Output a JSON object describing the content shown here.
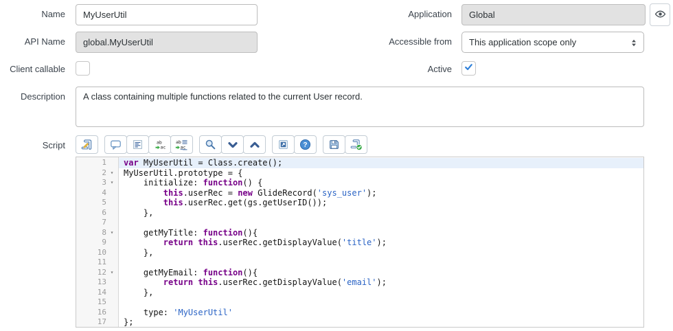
{
  "form": {
    "name": {
      "label": "Name",
      "value": "MyUserUtil"
    },
    "application": {
      "label": "Application",
      "value": "Global"
    },
    "api_name": {
      "label": "API Name",
      "value": "global.MyUserUtil"
    },
    "accessible_from": {
      "label": "Accessible from",
      "value": "This application scope only"
    },
    "client_callable": {
      "label": "Client callable",
      "checked": false
    },
    "active": {
      "label": "Active",
      "checked": true
    },
    "description": {
      "label": "Description",
      "value": "A class containing multiple functions related to the current User record."
    },
    "script": {
      "label": "Script"
    }
  },
  "toolbar": {
    "groups": [
      [
        "edit-script"
      ],
      [
        "toggle-comment",
        "format-code",
        "replace",
        "replace-all"
      ],
      [
        "search",
        "find-next",
        "find-previous"
      ],
      [
        "open-in-new-window",
        "help"
      ],
      [
        "save",
        "syntax-check"
      ]
    ]
  },
  "editor": {
    "colors": {
      "keyword": "#770088",
      "string": "#2a63c5",
      "active_line": "#e7f0fb"
    },
    "lines": [
      {
        "n": 1,
        "active": true,
        "fold": false,
        "tokens": [
          [
            "k",
            "var"
          ],
          [
            "t",
            " MyUserUtil = Class.create();"
          ]
        ]
      },
      {
        "n": 2,
        "active": false,
        "fold": true,
        "tokens": [
          [
            "t",
            "MyUserUtil.prototype = {"
          ]
        ]
      },
      {
        "n": 3,
        "active": false,
        "fold": true,
        "tokens": [
          [
            "t",
            "    initialize: "
          ],
          [
            "k",
            "function"
          ],
          [
            "t",
            "() {"
          ]
        ]
      },
      {
        "n": 4,
        "active": false,
        "fold": false,
        "tokens": [
          [
            "t",
            "        "
          ],
          [
            "k",
            "this"
          ],
          [
            "t",
            ".userRec = "
          ],
          [
            "k",
            "new"
          ],
          [
            "t",
            " GlideRecord("
          ],
          [
            "s",
            "'sys_user'"
          ],
          [
            "t",
            ");"
          ]
        ]
      },
      {
        "n": 5,
        "active": false,
        "fold": false,
        "tokens": [
          [
            "t",
            "        "
          ],
          [
            "k",
            "this"
          ],
          [
            "t",
            ".userRec.get(gs.getUserID());"
          ]
        ]
      },
      {
        "n": 6,
        "active": false,
        "fold": false,
        "tokens": [
          [
            "t",
            "    },"
          ]
        ]
      },
      {
        "n": 7,
        "active": false,
        "fold": false,
        "tokens": []
      },
      {
        "n": 8,
        "active": false,
        "fold": true,
        "tokens": [
          [
            "t",
            "    getMyTitle: "
          ],
          [
            "k",
            "function"
          ],
          [
            "t",
            "(){"
          ]
        ]
      },
      {
        "n": 9,
        "active": false,
        "fold": false,
        "tokens": [
          [
            "t",
            "        "
          ],
          [
            "k",
            "return"
          ],
          [
            "t",
            " "
          ],
          [
            "k",
            "this"
          ],
          [
            "t",
            ".userRec.getDisplayValue("
          ],
          [
            "s",
            "'title'"
          ],
          [
            "t",
            ");"
          ]
        ]
      },
      {
        "n": 10,
        "active": false,
        "fold": false,
        "tokens": [
          [
            "t",
            "    },"
          ]
        ]
      },
      {
        "n": 11,
        "active": false,
        "fold": false,
        "tokens": []
      },
      {
        "n": 12,
        "active": false,
        "fold": true,
        "tokens": [
          [
            "t",
            "    getMyEmail: "
          ],
          [
            "k",
            "function"
          ],
          [
            "t",
            "(){"
          ]
        ]
      },
      {
        "n": 13,
        "active": false,
        "fold": false,
        "tokens": [
          [
            "t",
            "        "
          ],
          [
            "k",
            "return"
          ],
          [
            "t",
            " "
          ],
          [
            "k",
            "this"
          ],
          [
            "t",
            ".userRec.getDisplayValue("
          ],
          [
            "s",
            "'email'"
          ],
          [
            "t",
            ");"
          ]
        ]
      },
      {
        "n": 14,
        "active": false,
        "fold": false,
        "tokens": [
          [
            "t",
            "    },"
          ]
        ]
      },
      {
        "n": 15,
        "active": false,
        "fold": false,
        "tokens": []
      },
      {
        "n": 16,
        "active": false,
        "fold": false,
        "tokens": [
          [
            "t",
            "    type: "
          ],
          [
            "s",
            "'MyUserUtil'"
          ]
        ]
      },
      {
        "n": 17,
        "active": false,
        "fold": false,
        "tokens": [
          [
            "t",
            "};"
          ]
        ]
      }
    ]
  }
}
